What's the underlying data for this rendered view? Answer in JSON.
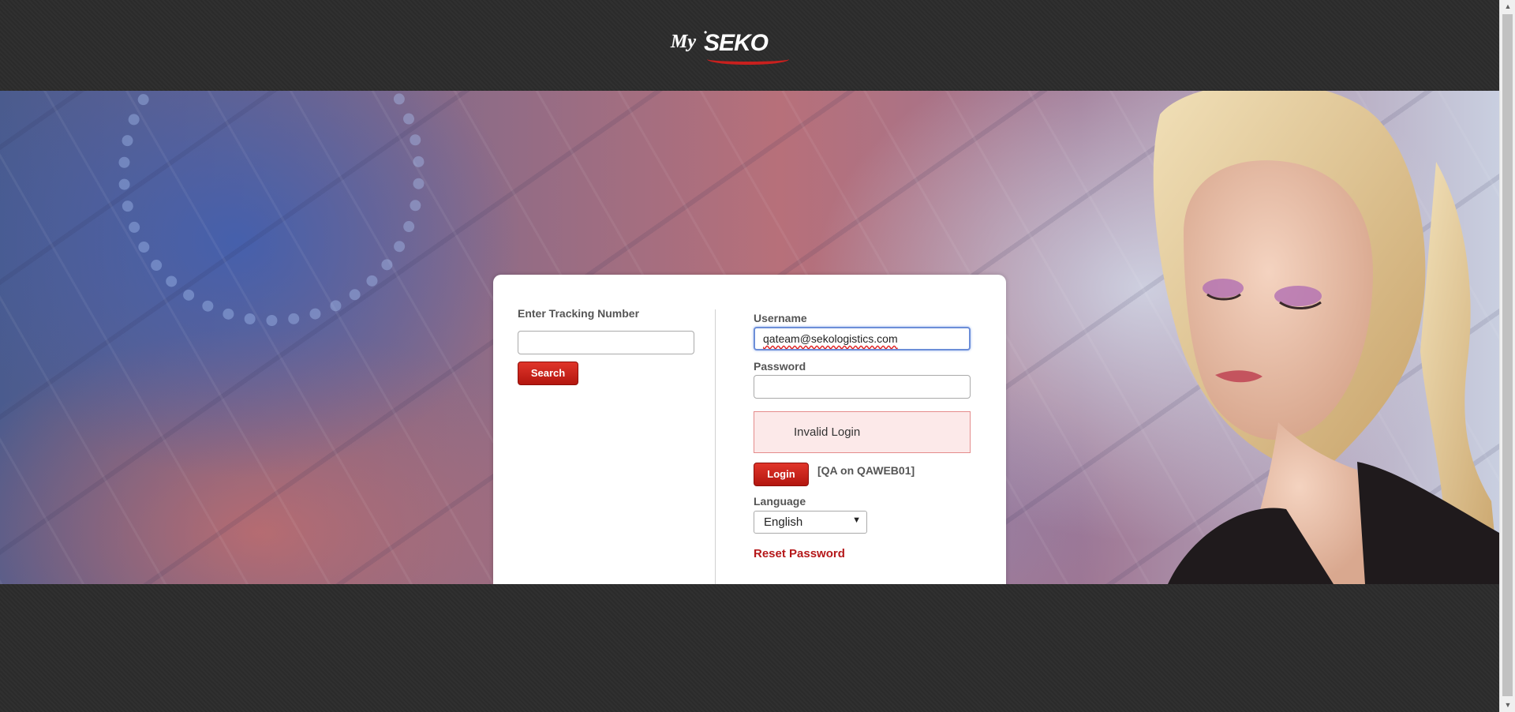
{
  "logo": {
    "alt": "My SEKO",
    "my": "My",
    "brand": "SEKO"
  },
  "tracking": {
    "label": "Enter Tracking Number",
    "value": "",
    "search_label": "Search"
  },
  "login": {
    "username_label": "Username",
    "username_value": "qateam@sekologistics.com",
    "password_label": "Password",
    "password_value": "",
    "error_message": "Invalid Login",
    "login_label": "Login",
    "environment": "[QA on QAWEB01]",
    "language_label": "Language",
    "language_selected": "English",
    "reset_password_label": "Reset Password"
  },
  "colors": {
    "brand_red": "#c8201e",
    "error_bg": "#fce9e9",
    "error_border": "#e48c8c",
    "focus_border": "#6c8ed8"
  }
}
